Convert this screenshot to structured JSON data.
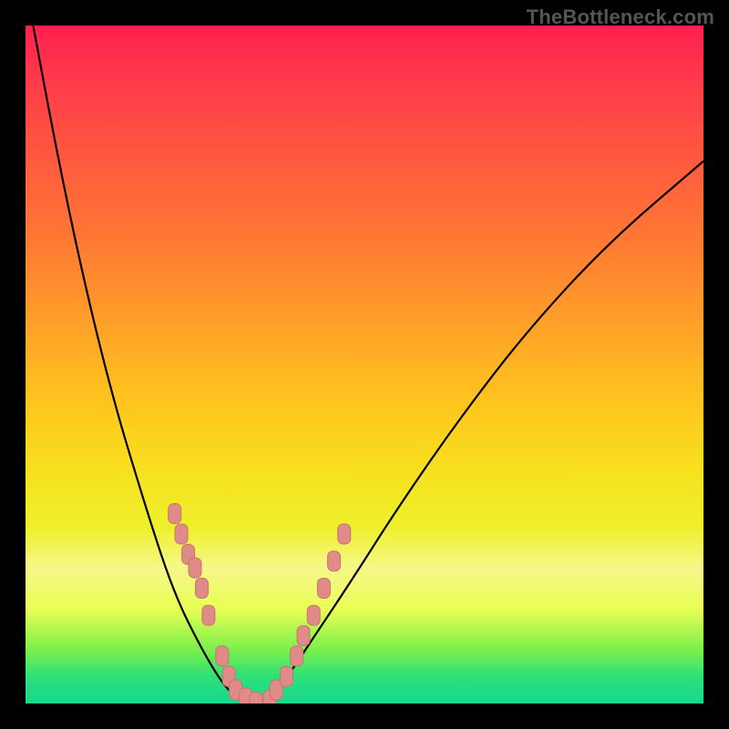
{
  "brand": {
    "text": "TheBottleneck.com"
  },
  "chart_data": {
    "type": "line",
    "title": "",
    "xlabel": "",
    "ylabel": "",
    "xlim": [
      0,
      100
    ],
    "ylim": [
      0,
      100
    ],
    "grid": false,
    "legend": false,
    "series": [
      {
        "name": "curve-left",
        "x": [
          0,
          6,
          12,
          18,
          22,
          26,
          29,
          31,
          33
        ],
        "values": [
          106,
          74,
          48,
          28,
          16,
          8,
          3,
          1,
          0
        ]
      },
      {
        "name": "curve-right",
        "x": [
          35,
          38,
          42,
          48,
          55,
          64,
          74,
          86,
          100
        ],
        "values": [
          0,
          3,
          9,
          18,
          29,
          42,
          55,
          68,
          80
        ]
      }
    ],
    "markers": [
      {
        "name": "left-cluster",
        "x": [
          22,
          23,
          24,
          25,
          26,
          27,
          29,
          30,
          31,
          32.5,
          34
        ],
        "values": [
          28,
          25,
          22,
          20,
          17,
          13,
          7,
          4,
          2,
          0.8,
          0.2
        ]
      },
      {
        "name": "right-cluster",
        "x": [
          36,
          37,
          38.5,
          40,
          41,
          42.5,
          44,
          45.5,
          47
        ],
        "values": [
          0.5,
          2,
          4,
          7,
          10,
          13,
          17,
          21,
          25
        ]
      }
    ],
    "colors": {
      "curve": "#000000",
      "marker_fill": "#e08b88",
      "marker_stroke": "#c97471"
    }
  }
}
